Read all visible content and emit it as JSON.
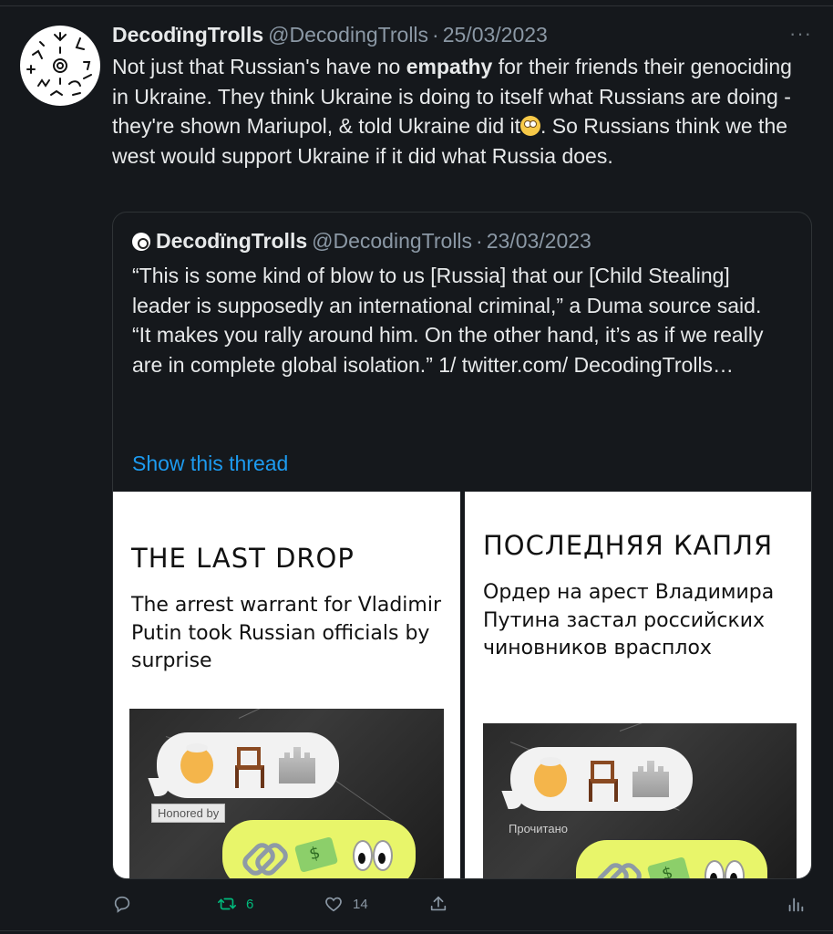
{
  "tweet": {
    "display_name": "DecodïngTrolls",
    "handle": "@DecodingTrolls",
    "separator": "·",
    "date": "25/03/2023",
    "more": "···",
    "text_part1": "Not just that Russian's have no ",
    "text_bold": "empathy",
    "text_part2": " for their friends their genociding in Ukraine. They think Ukraine is doing to itself what Russians are doing - they're shown Mariupol, & told Ukraine did it",
    "text_part3": ". So Russians think we the west would support Ukraine if it did what Russia does.",
    "emoji_icon": "face-with-rolling-eyes-icon"
  },
  "quote": {
    "display_name": "DecodïngTrolls",
    "handle": "@DecodingTrolls",
    "separator": "·",
    "date": "23/03/2023",
    "line1": "“This is some kind of blow to us [Russia] that our [Child Stealing] leader is supposedly an international criminal,” a Duma source said.",
    "line2": "“It makes you rally around him. On the other hand, it’s as if we really are in complete global isolation.” 1/ twitter.com/ DecodingTrolls…",
    "show_thread": "Show this thread"
  },
  "images": {
    "left": {
      "title": "THE LAST DROP",
      "subtitle": "The arrest warrant for Vladimir Putin took Russian officials by surprise",
      "tag": "Honored by"
    },
    "right": {
      "title": "ПОСЛЕДНЯЯ КАПЛЯ",
      "subtitle": "Ордер на арест Владимира Путина застал российских чиновников врасплох",
      "tag": "Прочитано"
    },
    "emoji_white_row": [
      "old-man-icon",
      "chair-icon",
      "castle-icon"
    ],
    "emoji_lime_row": [
      "link-icon",
      "money-with-wings-icon",
      "eyes-icon"
    ]
  },
  "actions": {
    "reply_icon": "reply-icon",
    "retweet_count": "6",
    "like_count": "14",
    "share_icon": "share-icon",
    "analytics_icon": "analytics-icon"
  },
  "colors": {
    "background": "#15181c",
    "text": "#e7e9ea",
    "muted": "#8b98a5",
    "link": "#1d9bf0",
    "retweet_active": "#00ba7c",
    "bubble_lime": "#e8f56a"
  }
}
